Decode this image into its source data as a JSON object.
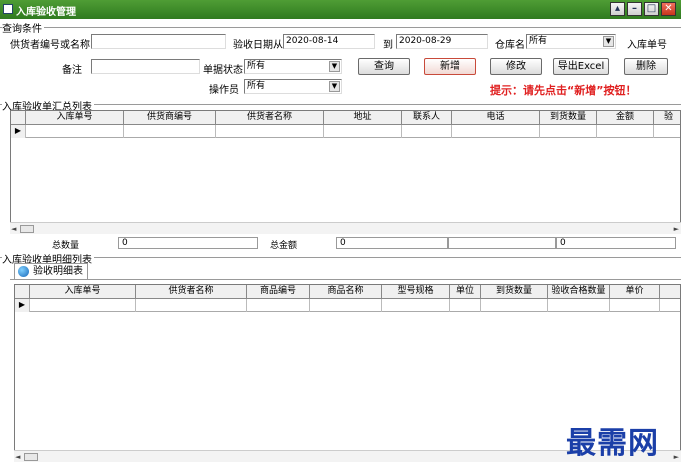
{
  "window": {
    "title": "入库验收管理"
  },
  "query": {
    "group_label": "查询条件",
    "supplier_label": "供货者编号或名称",
    "supplier_value": "",
    "date_from_label": "验收日期从",
    "date_from": "2020-08-14",
    "date_to_label": "到",
    "date_to": "2020-08-29",
    "warehouse_label": "仓库名",
    "warehouse_value": "所有",
    "inbound_no_label": "入库单号",
    "remark_label": "备注",
    "remark_value": "",
    "status_label": "单据状态",
    "status_value": "所有",
    "operator_label": "操作员",
    "operator_value": "所有"
  },
  "buttons": {
    "query": "查询",
    "add": "新增",
    "edit": "修改",
    "export": "导出Excel",
    "delete": "删除"
  },
  "hint": "提示：请先点击“新增”按钮！",
  "summary": {
    "group_label": "入库验收单汇总列表",
    "columns": [
      "入库单号",
      "供货商编号",
      "供货者名称",
      "地址",
      "联系人",
      "电话",
      "到货数量",
      "金额",
      "验"
    ]
  },
  "totals": {
    "qty_label": "总数量",
    "qty_value": "0",
    "amount_label": "总金额",
    "amount_value": "0",
    "extra_value": "0"
  },
  "detail": {
    "group_label": "入库验收单明细列表",
    "tab_label": "验收明细表",
    "columns": [
      "入库单号",
      "供货者名称",
      "商品编号",
      "商品名称",
      "型号规格",
      "单位",
      "到货数量",
      "验收合格数量",
      "单价"
    ]
  },
  "watermark": "最需网"
}
